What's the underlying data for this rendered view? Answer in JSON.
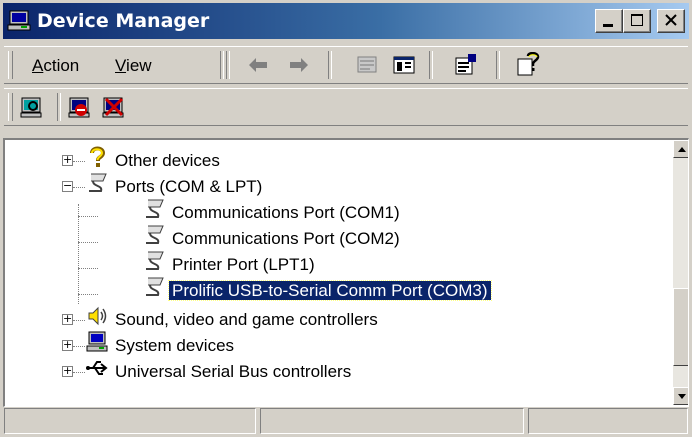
{
  "window": {
    "title": "Device Manager"
  },
  "title_buttons": [
    "minimize",
    "maximize",
    "close"
  ],
  "menu": [
    {
      "label": "Action",
      "underline": "A",
      "rest": "ction"
    },
    {
      "label": "View",
      "underline": "V",
      "rest": "iew"
    }
  ],
  "toolbar1_icons": [
    "back-arrow-icon",
    "forward-arrow-icon",
    "properties-sheet-icon",
    "show-hide-tree-icon",
    "properties-icon",
    "help-icon"
  ],
  "toolbar2_icons": [
    "scan-hardware-icon",
    "disable-device-icon",
    "uninstall-device-icon"
  ],
  "tree": {
    "items": [
      {
        "label": "Other devices",
        "level": 0,
        "expander": "+"
      },
      {
        "label": "Ports (COM & LPT)",
        "level": 0,
        "expander": "−"
      },
      {
        "label": "Communications Port (COM1)",
        "level": 1
      },
      {
        "label": "Communications Port (COM2)",
        "level": 1
      },
      {
        "label": "Printer Port (LPT1)",
        "level": 1
      },
      {
        "label": "Prolific USB-to-Serial Comm Port (COM3)",
        "level": 1,
        "selected": true
      },
      {
        "label": "Sound, video and game controllers",
        "level": 0,
        "expander": "+"
      },
      {
        "label": "System devices",
        "level": 0,
        "expander": "+"
      },
      {
        "label": "Universal Serial Bus controllers",
        "level": 0,
        "expander": "+"
      }
    ]
  },
  "colors": {
    "title_start": "#0a246a",
    "title_end": "#a6caf0",
    "selection": "#0a246a",
    "face": "#d4d0c8"
  }
}
